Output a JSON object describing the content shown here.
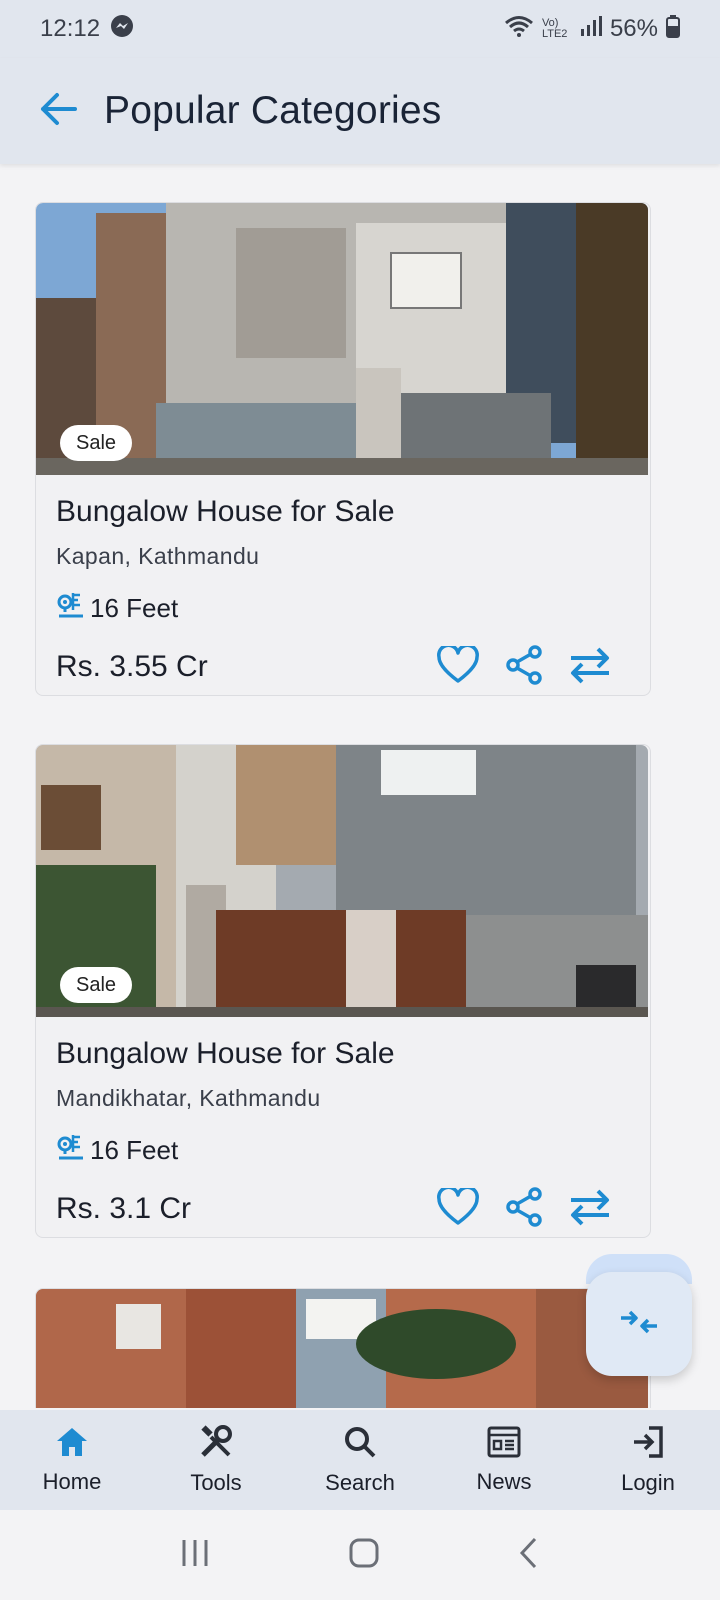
{
  "status_bar": {
    "time": "12:12",
    "network": "Vo) LTE2",
    "battery": "56%"
  },
  "header": {
    "title": "Popular Categories"
  },
  "listings": [
    {
      "badge": "Sale",
      "title": "Bungalow House for Sale",
      "location": "Kapan, Kathmandu",
      "size": "16 Feet",
      "price": "Rs. 3.55 Cr"
    },
    {
      "badge": "Sale",
      "title": "Bungalow House for Sale",
      "location": "Mandikhatar, Kathmandu",
      "size": "16 Feet",
      "price": "Rs. 3.1 Cr"
    }
  ],
  "bottom_nav": [
    {
      "label": "Home",
      "icon": "home-icon",
      "active": true
    },
    {
      "label": "Tools",
      "icon": "tools-icon"
    },
    {
      "label": "Search",
      "icon": "search-icon"
    },
    {
      "label": "News",
      "icon": "news-icon"
    },
    {
      "label": "Login",
      "icon": "login-icon"
    }
  ],
  "colors": {
    "accent": "#1e8bd1",
    "header_bg": "#e1e6ee",
    "page_bg": "#f3f3f5"
  }
}
